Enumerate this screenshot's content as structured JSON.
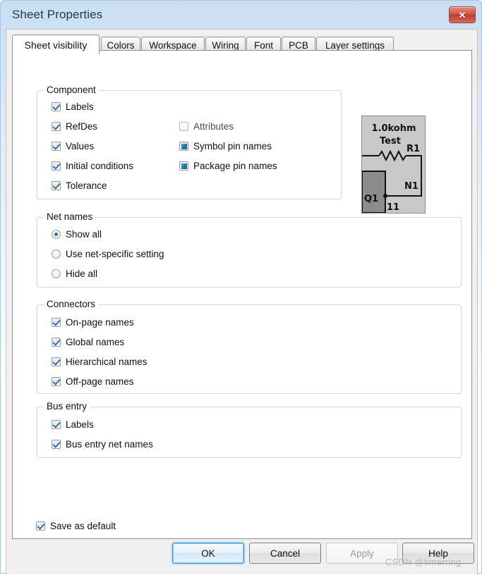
{
  "window": {
    "title": "Sheet Properties",
    "close_label": "✕",
    "frame_color": "#c9ddf2"
  },
  "tabs": [
    {
      "label": "Sheet visibility",
      "active": true
    },
    {
      "label": "Colors",
      "active": false
    },
    {
      "label": "Workspace",
      "active": false
    },
    {
      "label": "Wiring",
      "active": false
    },
    {
      "label": "Font",
      "active": false
    },
    {
      "label": "PCB",
      "active": false
    },
    {
      "label": "Layer settings",
      "active": false
    }
  ],
  "groups": {
    "component": {
      "title": "Component",
      "left_column": [
        {
          "label": "Labels",
          "state": "checked"
        },
        {
          "label": "RefDes",
          "state": "checked"
        },
        {
          "label": "Values",
          "state": "checked"
        },
        {
          "label": "Initial conditions",
          "state": "checked"
        },
        {
          "label": "Tolerance",
          "state": "checked"
        }
      ],
      "right_column": [
        {
          "label": "Attributes",
          "state": "unchecked"
        },
        {
          "label": "Symbol pin names",
          "state": "filled"
        },
        {
          "label": "Package pin names",
          "state": "filled"
        }
      ]
    },
    "net_names": {
      "title": "Net names",
      "options": [
        {
          "label": "Show all",
          "selected": true
        },
        {
          "label": "Use net-specific setting",
          "selected": false
        },
        {
          "label": "Hide all",
          "selected": false
        }
      ]
    },
    "connectors": {
      "title": "Connectors",
      "items": [
        {
          "label": "On-page names",
          "state": "checked"
        },
        {
          "label": "Global names",
          "state": "checked"
        },
        {
          "label": "Hierarchical names",
          "state": "checked"
        },
        {
          "label": "Off-page names",
          "state": "checked"
        }
      ]
    },
    "bus_entry": {
      "title": "Bus entry",
      "items": [
        {
          "label": "Labels",
          "state": "checked"
        },
        {
          "label": "Bus entry net names",
          "state": "checked"
        }
      ]
    }
  },
  "save_as_default": {
    "label": "Save as default",
    "state": "checked"
  },
  "preview": {
    "value_text": "1.0kohm",
    "tolerance_text": "Test",
    "refdes_text": "R1",
    "net_text": "N1",
    "component_text": "Q1",
    "pin_text": "11",
    "background": "#c9c9c9",
    "block_color": "#8c8c8c"
  },
  "buttons": [
    {
      "label": "OK",
      "style": "default"
    },
    {
      "label": "Cancel",
      "style": "normal"
    },
    {
      "label": "Apply",
      "style": "disabled"
    },
    {
      "label": "Help",
      "style": "normal"
    }
  ],
  "watermark": {
    "text": "CSDN @timerring"
  }
}
